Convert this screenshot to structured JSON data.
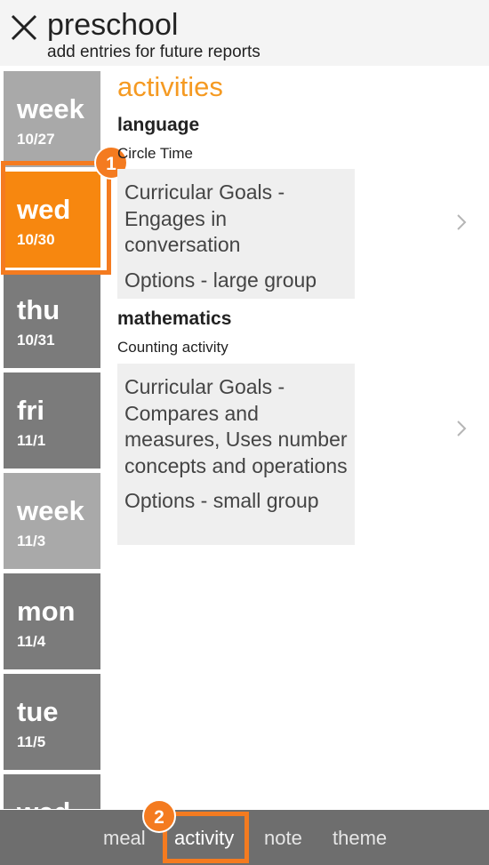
{
  "header": {
    "title": "preschool",
    "subtitle": "add entries for future reports"
  },
  "sidebar": {
    "days": [
      {
        "name": "week",
        "date": "10/27"
      },
      {
        "name": "wed",
        "date": "10/30"
      },
      {
        "name": "thu",
        "date": "10/31"
      },
      {
        "name": "fri",
        "date": "11/1"
      },
      {
        "name": "week",
        "date": "11/3"
      },
      {
        "name": "mon",
        "date": "11/4"
      },
      {
        "name": "tue",
        "date": "11/5"
      },
      {
        "name": "wed",
        "date": ""
      }
    ]
  },
  "main": {
    "section_title": "activities",
    "categories": [
      {
        "title": "language",
        "description": "Circle Time",
        "goal": "Curricular Goals - Engages in conversation",
        "options": "Options - large group"
      },
      {
        "title": "mathematics",
        "description": "Counting activity",
        "goal": "Curricular Goals - Compares and measures, Uses number concepts and operations",
        "options": "Options - small group"
      }
    ]
  },
  "badges": {
    "first": "1",
    "second": "2"
  },
  "tabs": [
    {
      "label": "meal"
    },
    {
      "label": "activity"
    },
    {
      "label": "note"
    },
    {
      "label": "theme"
    }
  ],
  "colors": {
    "accent": "#f7870f",
    "highlight": "#f47b20",
    "tab_bar": "#6e6e6e"
  }
}
